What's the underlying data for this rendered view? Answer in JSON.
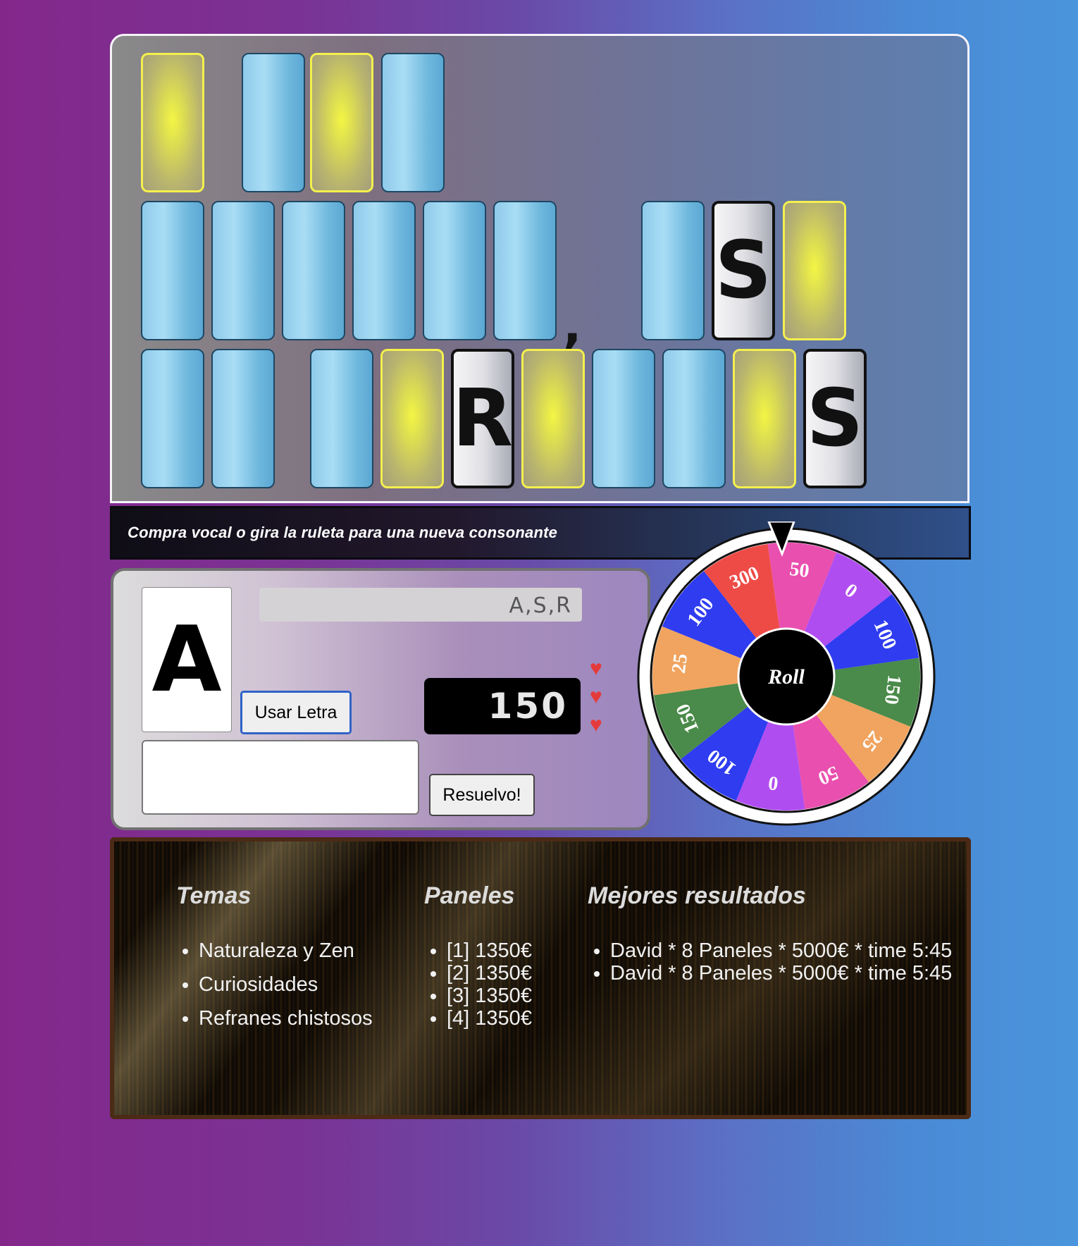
{
  "board": {
    "punctuation": ","
  },
  "message": "Compra vocal o gira la ruleta para una nueva consonante",
  "controls": {
    "current_letter": "A",
    "used_letters": "A,S,R",
    "use_letter_button": "Usar Letra",
    "solve_button": "Resuelvo!",
    "answer_value": "",
    "score": "150",
    "lives": 3
  },
  "wheel": {
    "center_label": "Roll",
    "segments": [
      "50",
      "0",
      "100",
      "150",
      "25",
      "50",
      "0",
      "100",
      "150",
      "25",
      "100",
      "300"
    ],
    "colors": {
      "pink": "#e94fae",
      "purple": "#b04df0",
      "blue": "#2f3cf0",
      "green": "#4a8a4a",
      "orange": "#f0a45f",
      "red": "#ee4b47"
    }
  },
  "stats": {
    "temas": {
      "title": "Temas",
      "items": [
        "Naturaleza y Zen",
        "Curiosidades",
        "Refranes chistosos"
      ]
    },
    "paneles": {
      "title": "Paneles",
      "items": [
        "[1] 1350€",
        "[2] 1350€",
        "[3] 1350€",
        "[4] 1350€"
      ]
    },
    "mejores": {
      "title": "Mejores resultados",
      "items": [
        "David * 8 Paneles * 5000€ * time 5:45",
        "David * 8 Paneles * 5000€ * time 5:45"
      ]
    }
  }
}
